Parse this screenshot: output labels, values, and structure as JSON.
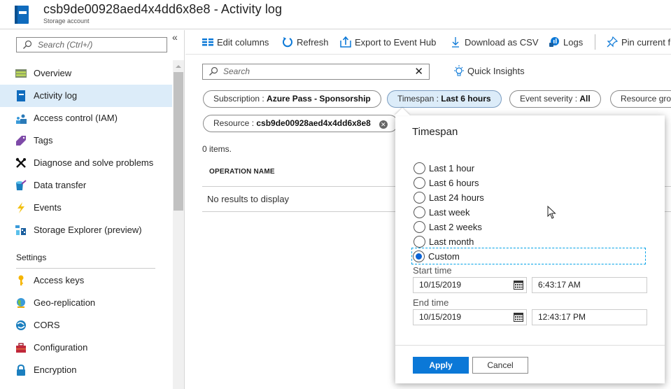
{
  "header": {
    "title": "csb9de00928aed4x4dd6x8e8 - Activity log",
    "subtitle": "Storage account",
    "icon": "activity-log-book-icon"
  },
  "sidebar": {
    "search_placeholder": "Search (Ctrl+/)",
    "collapse_glyph": "«",
    "items": [
      {
        "label": "Overview",
        "icon": "overview-icon",
        "active": false
      },
      {
        "label": "Activity log",
        "icon": "activity-log-icon",
        "active": true
      },
      {
        "label": "Access control (IAM)",
        "icon": "iam-people-icon",
        "active": false
      },
      {
        "label": "Tags",
        "icon": "tag-icon",
        "active": false
      },
      {
        "label": "Diagnose and solve problems",
        "icon": "wrench-screwdriver-icon",
        "active": false
      },
      {
        "label": "Data transfer",
        "icon": "data-transfer-icon",
        "active": false
      },
      {
        "label": "Events",
        "icon": "lightning-icon",
        "active": false
      },
      {
        "label": "Storage Explorer (preview)",
        "icon": "storage-explorer-icon",
        "active": false
      }
    ],
    "settings_label": "Settings",
    "settings_items": [
      {
        "label": "Access keys",
        "icon": "key-icon"
      },
      {
        "label": "Geo-replication",
        "icon": "globe-icon"
      },
      {
        "label": "CORS",
        "icon": "cors-icon"
      },
      {
        "label": "Configuration",
        "icon": "toolbox-icon"
      },
      {
        "label": "Encryption",
        "icon": "lock-icon"
      }
    ]
  },
  "toolbar": {
    "edit_columns": "Edit columns",
    "refresh": "Refresh",
    "export": "Export to Event Hub",
    "download": "Download as CSV",
    "logs": "Logs",
    "pin": "Pin current f"
  },
  "filters": {
    "search_placeholder": "Search",
    "clear_glyph": "✕",
    "quick_insights": "Quick Insights",
    "pills": [
      {
        "key": "Subscription : ",
        "value": "Azure Pass - Sponsorship"
      },
      {
        "key": "Timespan : ",
        "value": "Last 6 hours"
      },
      {
        "key": "Event severity : ",
        "value": "All"
      },
      {
        "key": "Resource gro",
        "value": ""
      },
      {
        "key": "Resource : ",
        "value": "csb9de00928aed4x4dd6x8e8"
      }
    ]
  },
  "results": {
    "count_text": "0 items.",
    "column_header": "OPERATION NAME",
    "empty_text": "No results to display"
  },
  "timespan_popup": {
    "title": "Timespan",
    "options": [
      "Last 1 hour",
      "Last 6 hours",
      "Last 24 hours",
      "Last week",
      "Last 2 weeks",
      "Last month",
      "Custom"
    ],
    "selected": "Custom",
    "start_label": "Start time",
    "start_date": "10/15/2019",
    "start_time": "6:43:17 AM",
    "end_label": "End time",
    "end_date": "10/15/2019",
    "end_time": "12:43:17 PM",
    "apply": "Apply",
    "cancel": "Cancel"
  },
  "colors": {
    "accent": "#0b78d7",
    "active_bg": "#dcecf9",
    "radio_selected": "#0a63d6"
  }
}
